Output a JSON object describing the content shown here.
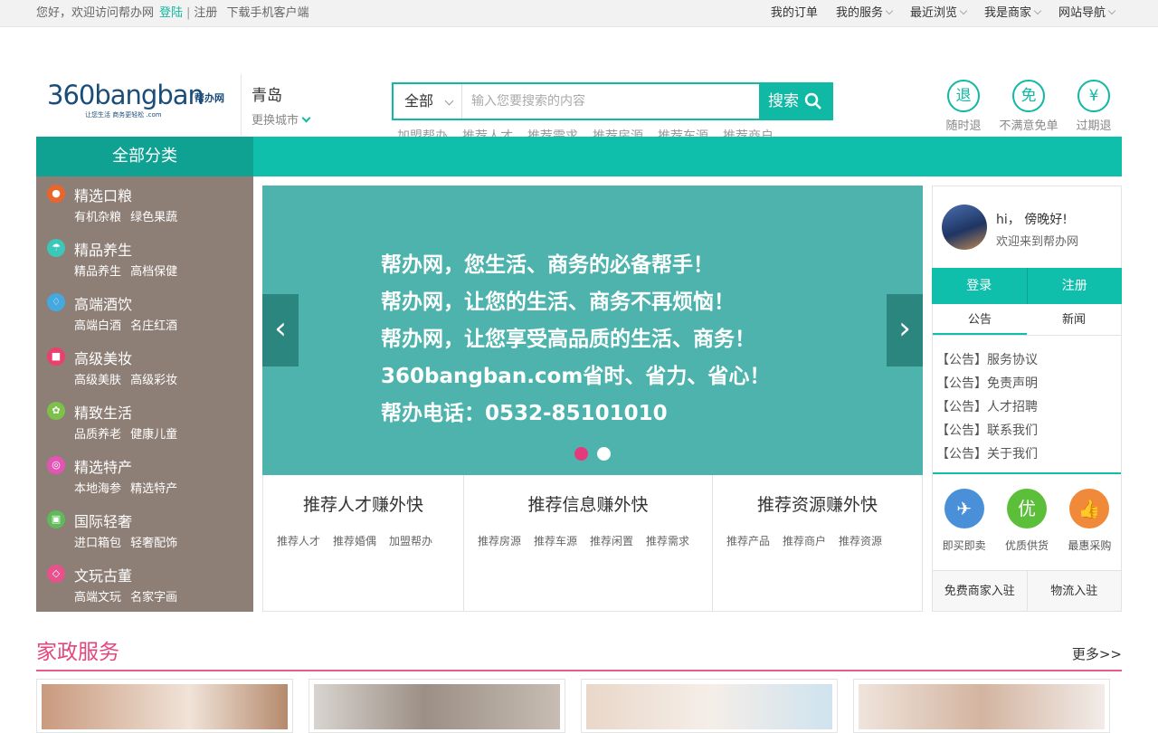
{
  "topbar": {
    "greeting": "您好，欢迎访问帮办网",
    "login": "登陆",
    "sep": "|",
    "register": "注册",
    "app_download": "下载手机客户端",
    "right_links": [
      "我的订单",
      "我的服务",
      "最近浏览",
      "我是商家",
      "网站导航"
    ]
  },
  "header": {
    "logo_text": "360bangban",
    "logo_cn": "帮办网",
    "logo_sub": "让您生活 商务更轻松  .com",
    "city": "青岛",
    "change_city": "更换城市",
    "search_category": "全部",
    "search_placeholder": "输入您要搜索的内容",
    "search_button": "搜索",
    "hot_words": [
      "加盟帮办",
      "推荐人才",
      "推荐需求",
      "推荐房源",
      "推荐车源",
      "推荐商户"
    ],
    "promises": [
      {
        "icon": "退",
        "label": "随时退"
      },
      {
        "icon": "免",
        "label": "不满意免单"
      },
      {
        "icon": "¥",
        "label": "过期退"
      }
    ]
  },
  "nav": {
    "all_categories": "全部分类"
  },
  "categories": [
    {
      "title": "精选口粮",
      "subs": "有机杂粮 绿色果蔬",
      "color": "#e8662c",
      "icon": "bowl-icon"
    },
    {
      "title": "精品养生",
      "subs": "精品养生 高档保健",
      "color": "#3cc7b8",
      "icon": "umbrella-icon"
    },
    {
      "title": "高端酒饮",
      "subs": "高端白酒 名庄红酒",
      "color": "#45a9e0",
      "icon": "wine-icon"
    },
    {
      "title": "高级美妆",
      "subs": "高级美肤 高级彩妆",
      "color": "#e8416e",
      "icon": "lock-icon"
    },
    {
      "title": "精致生活",
      "subs": "品质养老 健康儿童",
      "color": "#7dc14a",
      "icon": "flower-icon"
    },
    {
      "title": "精选特产",
      "subs": "本地海参 精选特产",
      "color": "#e255b4",
      "icon": "shell-icon"
    },
    {
      "title": "国际轻奢",
      "subs": "进口箱包 轻奢配饰",
      "color": "#5fba59",
      "icon": "bag-icon"
    },
    {
      "title": "文玩古董",
      "subs": "高端文玩 名家字画",
      "color": "#e8528c",
      "icon": "ring-icon"
    }
  ],
  "banner": {
    "lines": [
      "帮办网，您生活、商务的必备帮手！",
      "帮办网，让您的生活、商务不再烦恼！",
      "帮办网，让您享受高品质的生活、商务！",
      "360bangban.com省时、省力、省心！",
      "帮办电话：0532-85101010"
    ],
    "prev": "‹",
    "next": "›"
  },
  "recs": [
    {
      "title": "推荐人才赚外快",
      "links": [
        "推荐人才",
        "推荐婚偶",
        "加盟帮办"
      ]
    },
    {
      "title": "推荐信息赚外快",
      "links": [
        "推荐房源",
        "推荐车源",
        "推荐闲置",
        "推荐需求"
      ]
    },
    {
      "title": "推荐资源赚外快",
      "links": [
        "推荐产品",
        "推荐商户",
        "推荐资源"
      ]
    }
  ],
  "user": {
    "greeting": "hi， 傍晚好!",
    "welcome": "欢迎来到帮办网",
    "login": "登录",
    "register": "注册",
    "tabs": [
      "公告",
      "新闻"
    ],
    "notices": [
      "【公告】服务协议",
      "【公告】免责声明",
      "【公告】人才招聘",
      "【公告】联系我们",
      "【公告】关于我们"
    ],
    "services": [
      {
        "icon": "✈",
        "label": "即买即卖",
        "color": "#4a90d9"
      },
      {
        "icon": "优",
        "label": "优质供货",
        "color": "#5bbf3a"
      },
      {
        "icon": "👍",
        "label": "最惠采购",
        "color": "#f08a3a"
      }
    ],
    "join": [
      "免费商家入驻",
      "物流入驻"
    ]
  },
  "section": {
    "title": "家政服务",
    "more": "更多>>"
  }
}
